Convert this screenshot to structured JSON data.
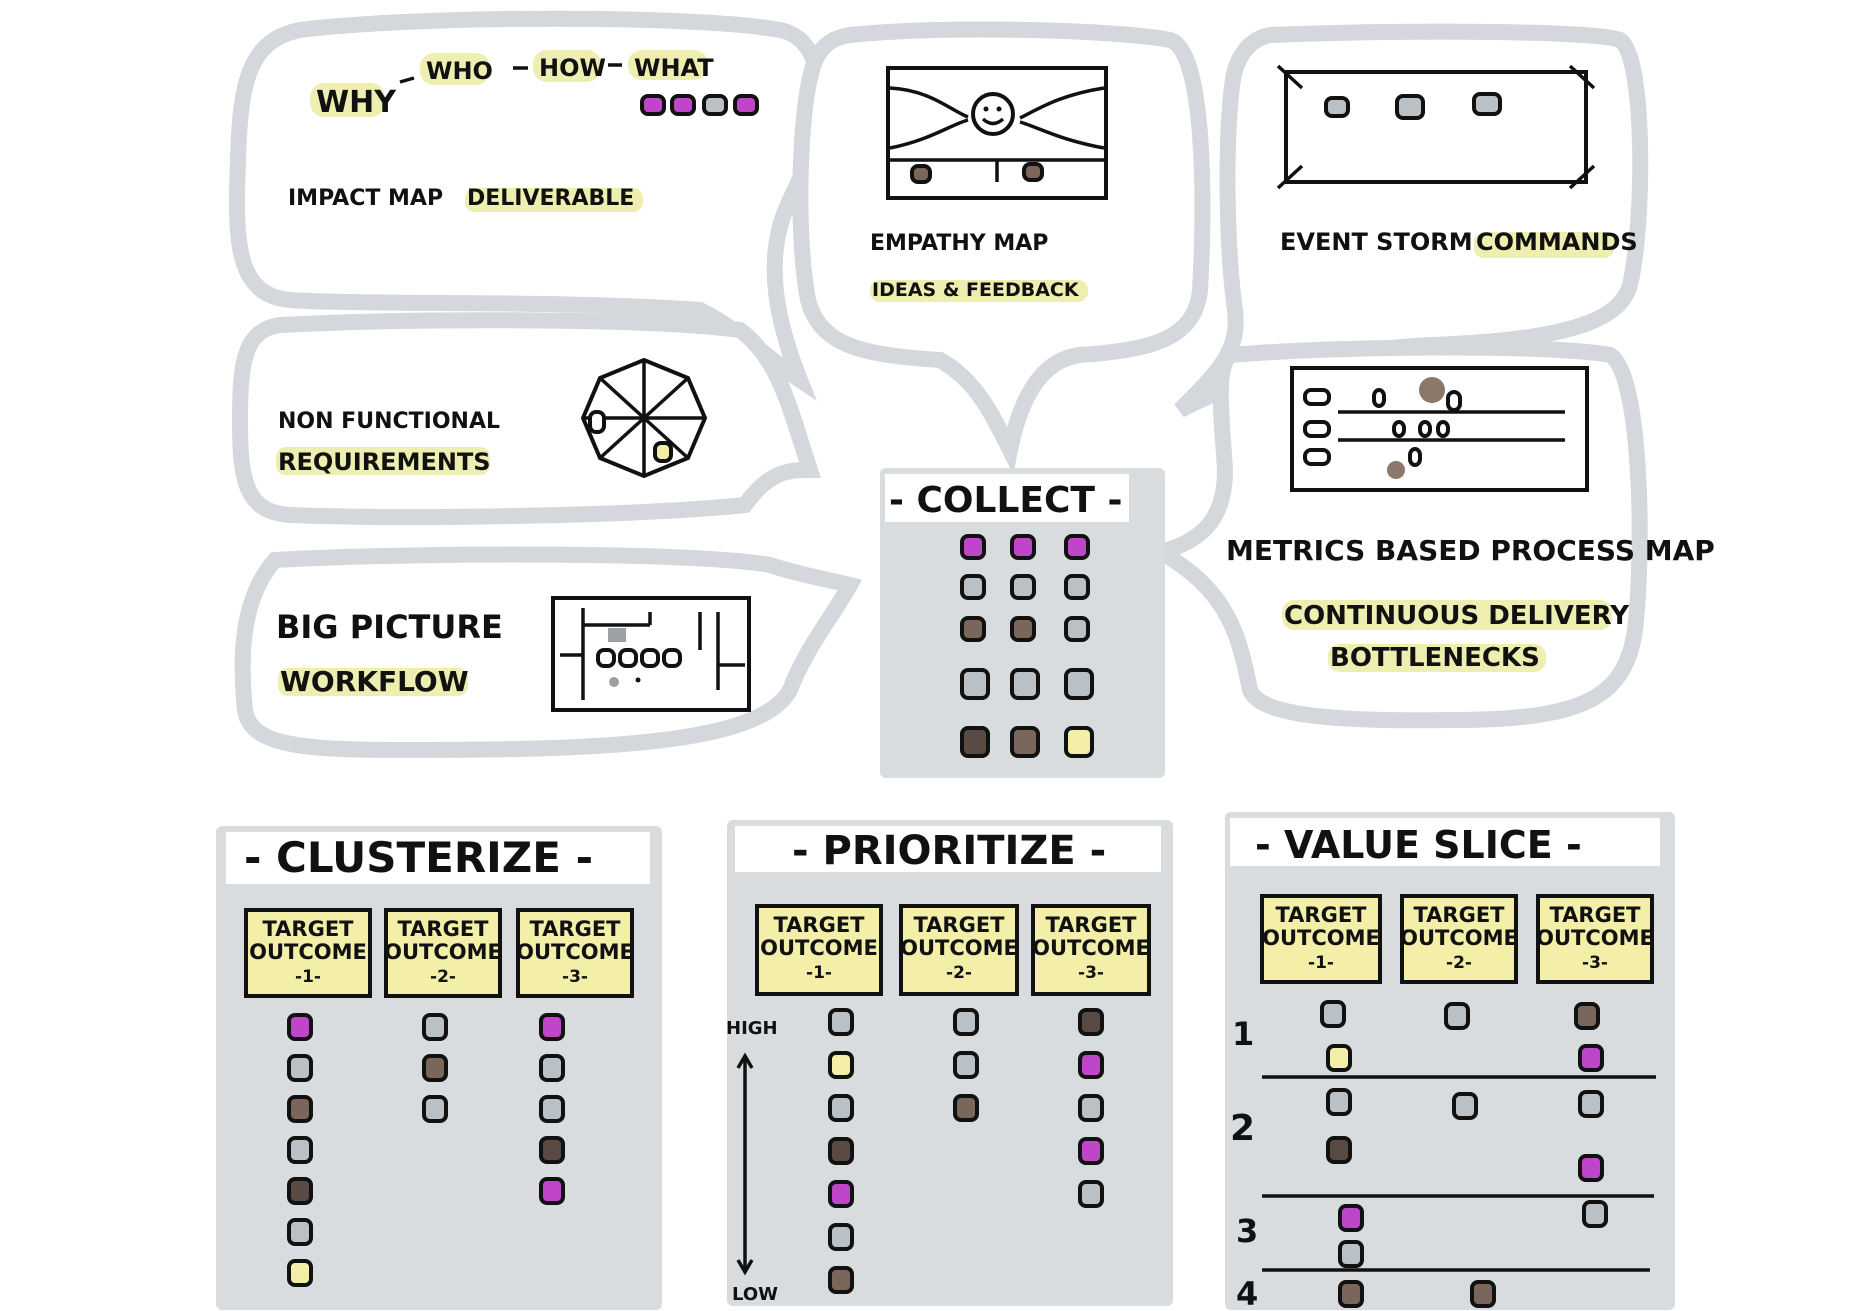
{
  "colors": {
    "panel": "#d9dcdf",
    "bubble_outline": "#d4d7db",
    "highlight": "#eeeeb0",
    "note_yellow": "#f3eea8",
    "sticky_pink": "#c046c9",
    "sticky_grey": "#b9c0c6",
    "sticky_brown": "#7a665a",
    "sticky_dark": "#5a4a44",
    "sticky_yellow": "#f3eea8"
  },
  "bubbles": {
    "impact_map": {
      "why": "WHY",
      "who": "WHO",
      "how": "HOW",
      "what": "WHAT",
      "title": "IMPACT MAP",
      "subtitle": "DELIVERABLE"
    },
    "empathy_map": {
      "title": "EMPATHY MAP",
      "subtitle": "IDEAS & FEEDBACK"
    },
    "event_storm": {
      "title": "EVENT STORM",
      "subtitle": "COMMANDS"
    },
    "non_functional": {
      "line1": "NON FUNCTIONAL",
      "line2": "REQUIREMENTS"
    },
    "big_picture": {
      "line1": "BIG PICTURE",
      "line2": "WORKFLOW"
    },
    "metrics": {
      "title": "METRICS BASED PROCESS MAP",
      "line2": "CONTINUOUS DELIVERY",
      "line3": "BOTTLENECKS"
    }
  },
  "collect": {
    "title": "- COLLECT -"
  },
  "clusterize": {
    "title": "- CLUSTERIZE -",
    "columns": [
      {
        "line1": "TARGET",
        "line2": "OUTCOME",
        "line3": "-1-",
        "stickies": [
          "pink",
          "grey",
          "brown",
          "grey",
          "dark",
          "grey",
          "yellow"
        ]
      },
      {
        "line1": "TARGET",
        "line2": "OUTCOME",
        "line3": "-2-",
        "stickies": [
          "grey",
          "brown",
          "grey"
        ]
      },
      {
        "line1": "TARGET",
        "line2": "OUTCOME",
        "line3": "-3-",
        "stickies": [
          "pink",
          "grey",
          "grey",
          "dark",
          "pink"
        ]
      }
    ]
  },
  "prioritize": {
    "title": "- PRIORITIZE -",
    "high_label": "HIGH",
    "low_label": "LOW",
    "columns": [
      {
        "line1": "TARGET",
        "line2": "OUTCOME",
        "line3": "-1-",
        "stickies": [
          "grey",
          "yellow",
          "grey",
          "dark",
          "pink",
          "grey",
          "brown"
        ]
      },
      {
        "line1": "TARGET",
        "line2": "OUTCOME",
        "line3": "-2-",
        "stickies": [
          "grey",
          "grey",
          "brown"
        ]
      },
      {
        "line1": "TARGET",
        "line2": "OUTCOME",
        "line3": "-3-",
        "stickies": [
          "dark",
          "pink",
          "grey",
          "pink",
          "grey"
        ]
      }
    ]
  },
  "value_slice": {
    "title": "- VALUE SLICE -",
    "row_labels": [
      "1",
      "2",
      "3",
      "4"
    ],
    "columns": [
      {
        "line1": "TARGET",
        "line2": "OUTCOME",
        "line3": "-1-"
      },
      {
        "line1": "TARGET",
        "line2": "OUTCOME",
        "line3": "-2-"
      },
      {
        "line1": "TARGET",
        "line2": "OUTCOME",
        "line3": "-3-"
      }
    ]
  }
}
